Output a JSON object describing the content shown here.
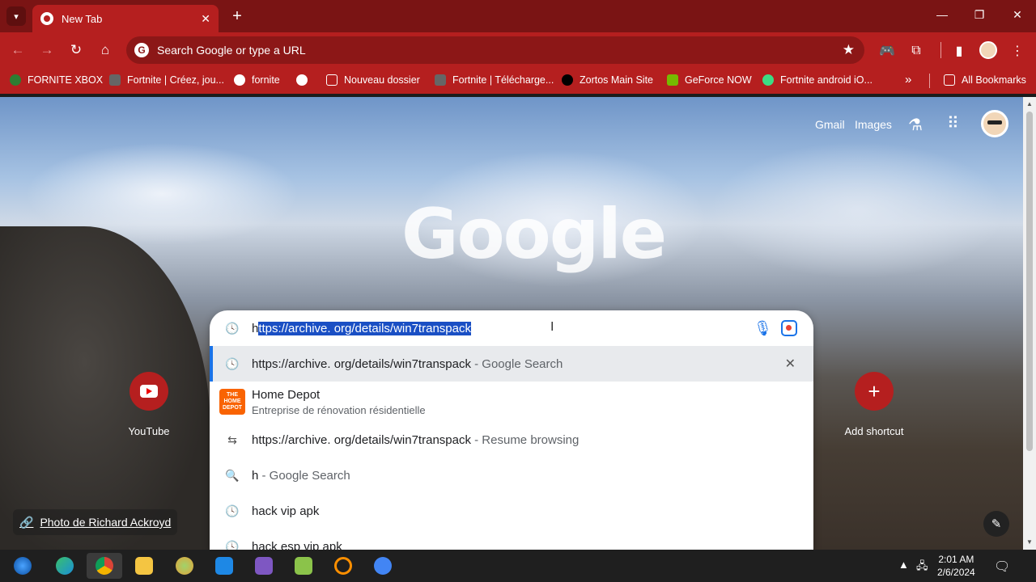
{
  "window": {
    "tab_title": "New Tab",
    "controls": [
      "—",
      "❐",
      "✕"
    ]
  },
  "toolbar": {
    "omnibox_placeholder": "Search Google or type a URL"
  },
  "bookmarks": [
    {
      "label": "FORNITE XBOX",
      "color": "#2e7d32"
    },
    {
      "label": "Fortnite | Créez, jou...",
      "color": "#666666"
    },
    {
      "label": "fornite",
      "color": "#ffffff"
    },
    {
      "label": "",
      "color": "#ffffff"
    },
    {
      "label": "Nouveau dossier",
      "color": "#ffffff"
    },
    {
      "label": "Fortnite | Télécharge...",
      "color": "#666666"
    },
    {
      "label": "Zortos Main Site",
      "color": "#000000"
    },
    {
      "label": "GeForce NOW",
      "color": "#76b900"
    },
    {
      "label": "Fortnite android iO...",
      "color": "#3ddc84"
    }
  ],
  "all_bookmarks": "All Bookmarks",
  "page": {
    "gmail": "Gmail",
    "images": "Images",
    "google_logo": "Google",
    "photo_credit": "Photo de Richard Ackroyd"
  },
  "shortcuts": {
    "youtube": "YouTube",
    "add": "Add shortcut"
  },
  "search": {
    "input_first_char": "h",
    "input_selected": "ttps://archive. org/details/win7transpack",
    "suggestions": [
      {
        "text": "https://archive. org/details/win7transpack",
        "suffix": " - Google Search"
      },
      {
        "title": "Home Depot",
        "subtitle": "Entreprise de rénovation résidentielle",
        "logo": "THE HOME DEPOT"
      },
      {
        "text": "https://archive. org/details/win7transpack",
        "suffix": " - Resume browsing"
      },
      {
        "text": "h",
        "suffix": " - Google Search"
      },
      {
        "text": "hack vip apk",
        "suffix": ""
      },
      {
        "text": "hack esp vip apk",
        "suffix": ""
      }
    ]
  },
  "taskbar": {
    "time": "2:01 AM",
    "date": "2/6/2024"
  },
  "colors": {
    "chrome_dark": "#7a1414",
    "chrome_main": "#b51f1f",
    "selection": "#1a4fc4"
  }
}
